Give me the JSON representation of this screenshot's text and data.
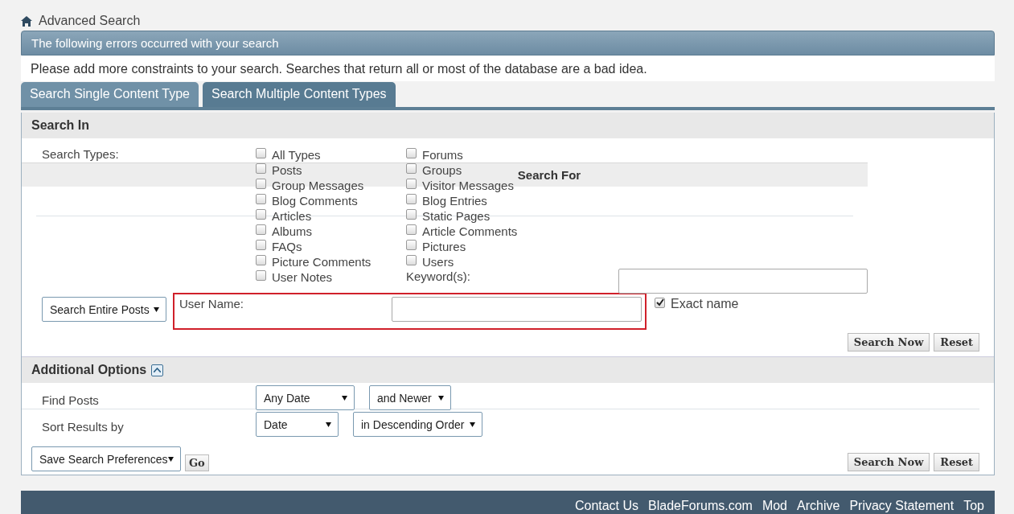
{
  "breadcrumb": {
    "title": "Advanced Search"
  },
  "error": {
    "title": "The following errors occurred with your search",
    "message": "Please add more constraints to your search. Searches that return all or most of the database are a bad idea."
  },
  "tabs": [
    {
      "label": "Search Single Content Type",
      "selected": false
    },
    {
      "label": "Search Multiple Content Types",
      "selected": true
    }
  ],
  "search_in": {
    "title": "Search In",
    "types_label": "Search Types:",
    "search_for_title": "Search For",
    "type_columns": [
      {
        "items": [
          {
            "label": "All Types",
            "checked": false
          },
          {
            "label": "Posts",
            "checked": false
          },
          {
            "label": "Group Messages",
            "checked": false
          },
          {
            "label": "Blog Comments",
            "checked": false
          },
          {
            "label": "Articles",
            "checked": false
          },
          {
            "label": "Albums",
            "checked": false
          },
          {
            "label": "FAQs",
            "checked": false
          },
          {
            "label": "Picture Comments",
            "checked": false
          },
          {
            "label": "User Notes",
            "checked": false
          }
        ]
      },
      {
        "items": [
          {
            "label": "Forums",
            "checked": false
          },
          {
            "label": "Groups",
            "checked": false
          },
          {
            "label": "Visitor Messages",
            "checked": false
          },
          {
            "label": "Blog Entries",
            "checked": false
          },
          {
            "label": "Static Pages",
            "checked": false
          },
          {
            "label": "Article Comments",
            "checked": false
          },
          {
            "label": "Pictures",
            "checked": false
          },
          {
            "label": "Users",
            "checked": false
          }
        ]
      }
    ],
    "keyword_label": "Keyword(s):",
    "scope_select": "Search Entire Posts",
    "user_name_label": "User Name:",
    "exact_name": {
      "label": "Exact name",
      "checked": true
    },
    "buttons": [
      "Search Now",
      "Reset"
    ]
  },
  "additional": {
    "title": "Additional Options",
    "rows": [
      {
        "label": "Find Posts",
        "selects": [
          "Any Date",
          "and Newer"
        ]
      },
      {
        "label": "Sort Results by",
        "selects": [
          "Date",
          "in Descending Order"
        ]
      }
    ],
    "preferences_select": "Save Search Preferences",
    "go_button": "Go",
    "buttons": [
      "Search Now",
      "Reset"
    ]
  },
  "footer": {
    "links": [
      "Contact Us",
      "BladeForums.com",
      "Mod",
      "Archive",
      "Privacy Statement",
      "Top"
    ]
  }
}
